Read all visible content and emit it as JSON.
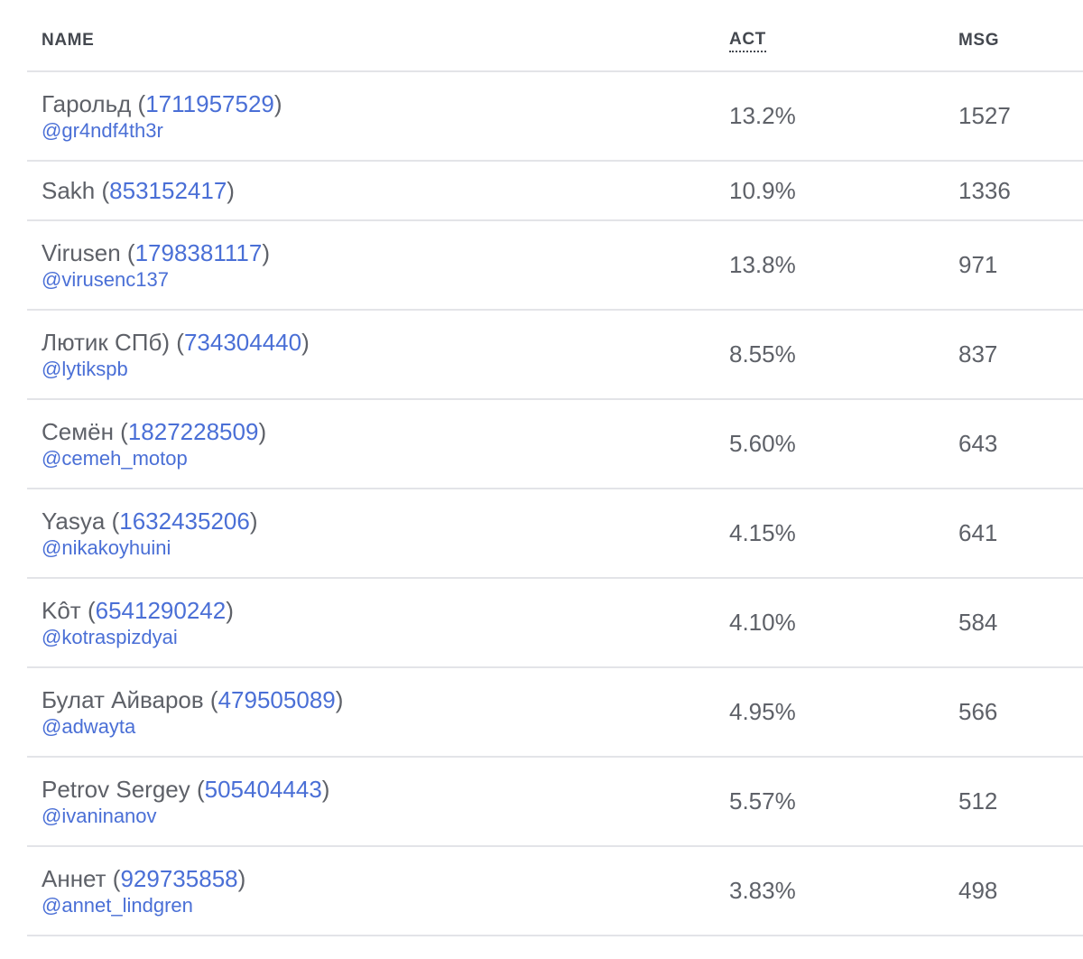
{
  "table": {
    "headers": {
      "name": "NAME",
      "act": "ACT",
      "msg": "MSG"
    },
    "rows": [
      {
        "name": "Гарольд",
        "id": "1711957529",
        "handle": "@gr4ndf4th3r",
        "act": "13.2%",
        "msg": "1527"
      },
      {
        "name": "Sakh",
        "id": "853152417",
        "handle": "",
        "act": "10.9%",
        "msg": "1336"
      },
      {
        "name": "Virusen",
        "id": "1798381117",
        "handle": "@virusenc137",
        "act": "13.8%",
        "msg": "971"
      },
      {
        "name": "Лютик СПб)",
        "id": "734304440",
        "handle": "@lytikspb",
        "act": "8.55%",
        "msg": "837"
      },
      {
        "name": "Семён",
        "id": "1827228509",
        "handle": "@cemeh_motop",
        "act": "5.60%",
        "msg": "643"
      },
      {
        "name": "Yasya",
        "id": "1632435206",
        "handle": "@nikakoyhuini",
        "act": "4.15%",
        "msg": "641"
      },
      {
        "name": "Kôт",
        "id": "6541290242",
        "handle": "@kotraspizdyai",
        "act": "4.10%",
        "msg": "584"
      },
      {
        "name": "Булат Айваров",
        "id": "479505089",
        "handle": "@adwayta",
        "act": "4.95%",
        "msg": "566"
      },
      {
        "name": "Petrov Sergey",
        "id": "505404443",
        "handle": "@ivaninanov",
        "act": "5.57%",
        "msg": "512"
      },
      {
        "name": "Аннет",
        "id": "929735858",
        "handle": "@annet_lindgren",
        "act": "3.83%",
        "msg": "498"
      }
    ]
  },
  "colors": {
    "text": "#5e6168",
    "link": "#4a6fd6",
    "header": "#44484f",
    "divider": "#e3e4e8"
  }
}
